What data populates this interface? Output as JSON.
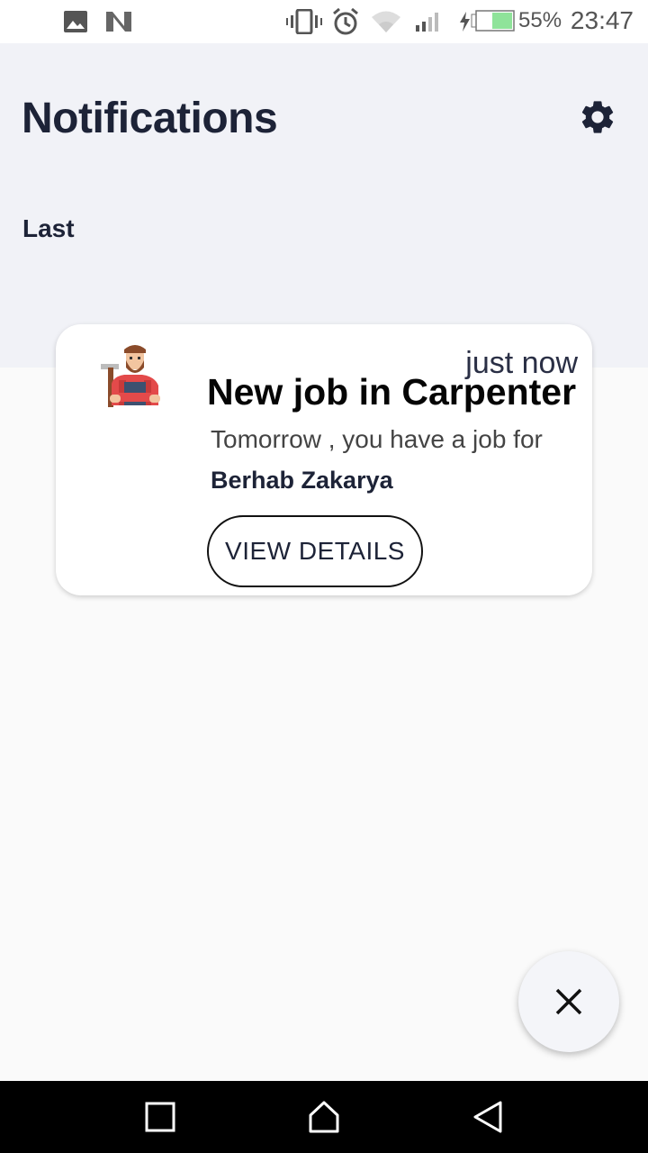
{
  "status_bar": {
    "battery": "55%",
    "time": "23:47",
    "icons": [
      "image-icon",
      "n-app-icon",
      "vibrate-icon",
      "alarm-icon",
      "wifi-icon",
      "signal-icon",
      "battery-charging-icon"
    ]
  },
  "header": {
    "title": "Notifications",
    "section_label": "Last",
    "settings_icon": "gear-icon"
  },
  "notifications": [
    {
      "time": "just now",
      "title": "New job in Carpenter",
      "subtitle": "Tomorrow , you have a job for",
      "name": "Berhab Zakarya",
      "button_label": "VIEW DETAILS",
      "avatar_icon": "carpenter-avatar-icon"
    }
  ],
  "fab": {
    "icon": "close-icon"
  },
  "nav_bar": {
    "icons": [
      "recents-icon",
      "home-icon",
      "back-icon"
    ]
  },
  "colors": {
    "header_bg": "#f1f2f7",
    "title_text": "#1d2337",
    "card_bg": "#ffffff",
    "page_bg": "#fafafa"
  }
}
